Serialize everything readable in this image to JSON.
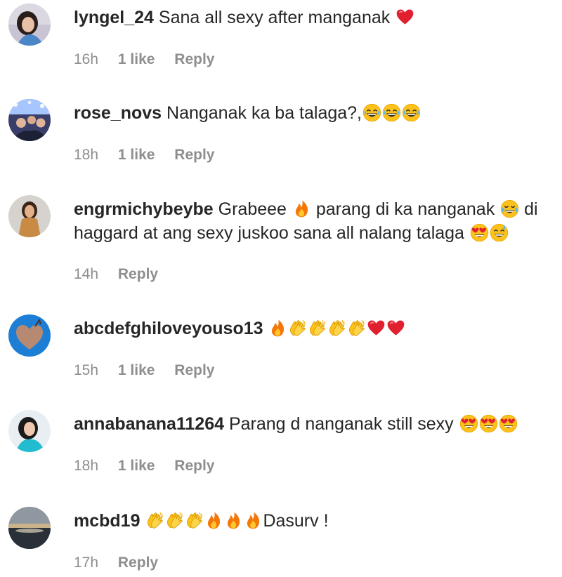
{
  "colors": {
    "username": "#262626",
    "meta": "#8e8e8e"
  },
  "comments": [
    {
      "username": "lyngel_24",
      "text": "Sana all sexy after manganak",
      "emoji_after": [
        "heart"
      ],
      "time": "16h",
      "likes": "1 like",
      "reply": "Reply"
    },
    {
      "username": "rose_novs",
      "text": "Nanganak ka ba talaga?,",
      "emoji_after": [
        "grin-sweat",
        "grin-sweat",
        "grin-sweat"
      ],
      "time": "18h",
      "likes": "1 like",
      "reply": "Reply"
    },
    {
      "username": "engrmichybeybe",
      "text_parts": [
        "Grabeee",
        "parang di ka nanganak",
        "di",
        "haggard at ang sexy juskoo sana all nalang talaga"
      ],
      "emoji_inline": [
        "fire",
        "joy",
        "heart-eyes",
        "sweat-smile"
      ],
      "time": "14h",
      "reply": "Reply"
    },
    {
      "username": "abcdefghiloveyouso13",
      "text": "",
      "emoji_after": [
        "fire",
        "clap",
        "clap",
        "clap",
        "clap",
        "heart",
        "heart"
      ],
      "time": "15h",
      "likes": "1 like",
      "reply": "Reply"
    },
    {
      "username": "annabanana11264",
      "text": "Parang d nanganak still sexy",
      "emoji_after": [
        "heart-eyes",
        "heart-eyes",
        "heart-eyes"
      ],
      "time": "18h",
      "likes": "1 like",
      "reply": "Reply"
    },
    {
      "username": "mcbd19",
      "text_suffix": "Dasurv !",
      "emoji_before": [
        "clap",
        "clap",
        "clap",
        "fire",
        "fire",
        "fire"
      ],
      "time": "17h",
      "reply": "Reply"
    }
  ]
}
